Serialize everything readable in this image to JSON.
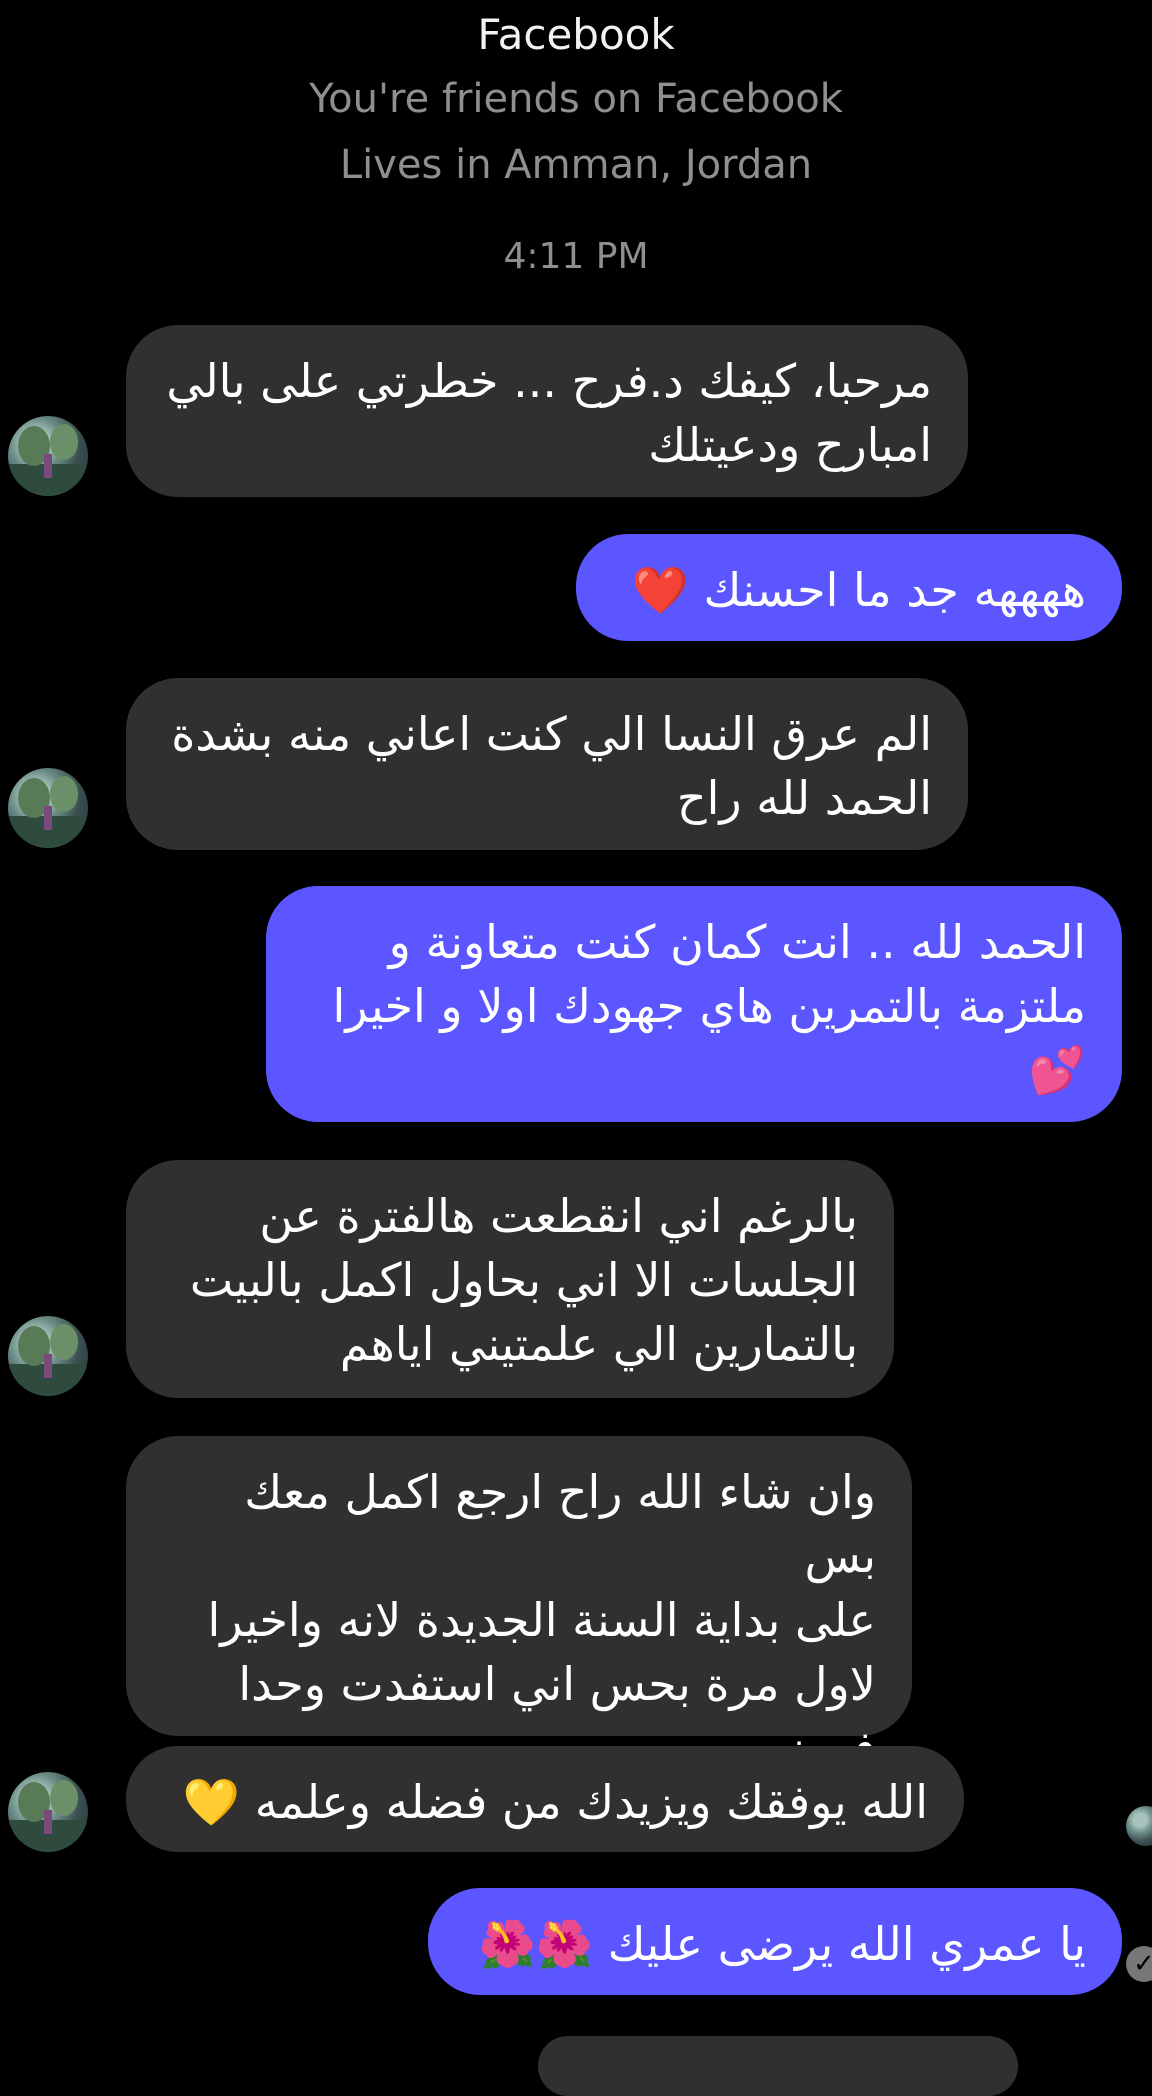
{
  "header": {
    "title": "Facebook",
    "friend_status": "You're friends on Facebook",
    "location": "Lives in Amman, Jordan"
  },
  "timestamp": "4:11 PM",
  "messages": [
    {
      "direction": "incoming",
      "text": "مرحبا، كيفك د.فرح ... خطرتي على بالي\nامبارح ودعيتلك"
    },
    {
      "direction": "outgoing",
      "text": "ههههه جد ما احسنك ❤️"
    },
    {
      "direction": "incoming",
      "text": "الم عرق النسا الي كنت اعاني منه بشدة\nالحمد لله راح"
    },
    {
      "direction": "outgoing",
      "text": "الحمد لله .. انت كمان كنت متعاونة و\nملتزمة بالتمرين هاي جهودك اولا و اخيرا\n💕"
    },
    {
      "direction": "incoming",
      "text": "بالرغم اني انقطعت هالفترة عن\nالجلسات الا اني بحاول اكمل بالبيت\nبالتمارين الي علمتيني اياهم"
    },
    {
      "direction": "incoming",
      "text": "وان شاء الله راح ارجع اكمل معك بس\nعلى بداية السنة الجديدة لانه واخيرا\nلاول مرة بحس اني استفدت وحدا\nفهمني"
    },
    {
      "direction": "incoming",
      "text": "الله يوفقك ويزيدك من فضله وعلمه 💛"
    },
    {
      "direction": "outgoing",
      "text": "يا عمري الله يرضى عليك 🌺🌺"
    }
  ],
  "seen_check_icon": "✓",
  "colors": {
    "background": "#000000",
    "incoming_bubble": "#303030",
    "outgoing_bubble": "#5b56ff",
    "muted_text": "#8f8f93"
  }
}
